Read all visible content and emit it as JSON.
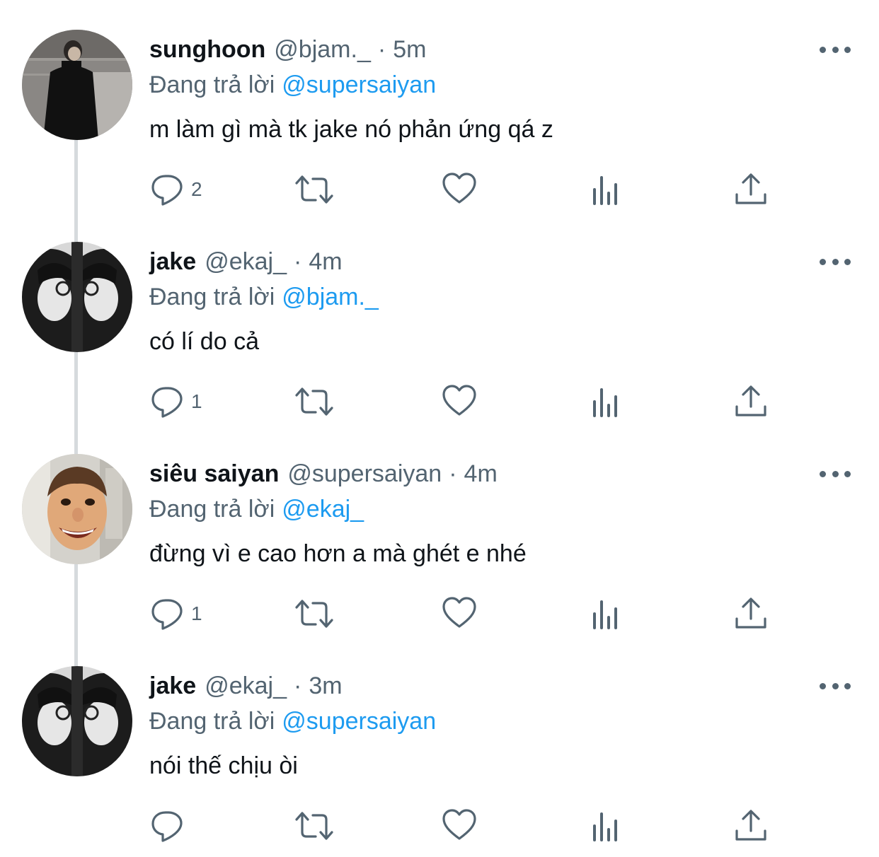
{
  "tweets": [
    {
      "name": "sunghoon",
      "handle": "@bjam._",
      "separator": "·",
      "time": "5m",
      "replying_prefix": "Đang trả lời",
      "replying_to": "@supersaiyan",
      "text": "m làm gì mà tk jake nó phản ứng qá z",
      "reply_count": "2",
      "avatar": "dark-photo-standing-person"
    },
    {
      "name": "jake",
      "handle": "@ekaj_",
      "separator": "·",
      "time": "4m",
      "replying_prefix": "Đang trả lời",
      "replying_to": "@bjam._",
      "text": "có lí do cả",
      "reply_count": "1",
      "avatar": "mirror-glasses-bw-photo"
    },
    {
      "name": "siêu saiyan",
      "handle": "@supersaiyan",
      "separator": "·",
      "time": "4m",
      "replying_prefix": "Đang trả lời",
      "replying_to": "@ekaj_",
      "text": "đừng vì e cao hơn a mà ghét e nhé",
      "reply_count": "1",
      "avatar": "puppet-face-photo"
    },
    {
      "name": "jake",
      "handle": "@ekaj_",
      "separator": "·",
      "time": "3m",
      "replying_prefix": "Đang trả lời",
      "replying_to": "@supersaiyan",
      "text": "nói thế chịu òi",
      "reply_count": "",
      "avatar": "mirror-glasses-bw-photo"
    }
  ],
  "icons": {
    "reply": "speech-bubble-icon",
    "retweet": "retweet-icon",
    "like": "heart-icon",
    "analytics": "bar-chart-icon",
    "share": "share-icon",
    "more": "more-dots-icon"
  },
  "colors": {
    "text_primary": "#0f1419",
    "text_secondary": "#536471",
    "mention": "#1d9bf0",
    "connector": "#d6dadd"
  }
}
